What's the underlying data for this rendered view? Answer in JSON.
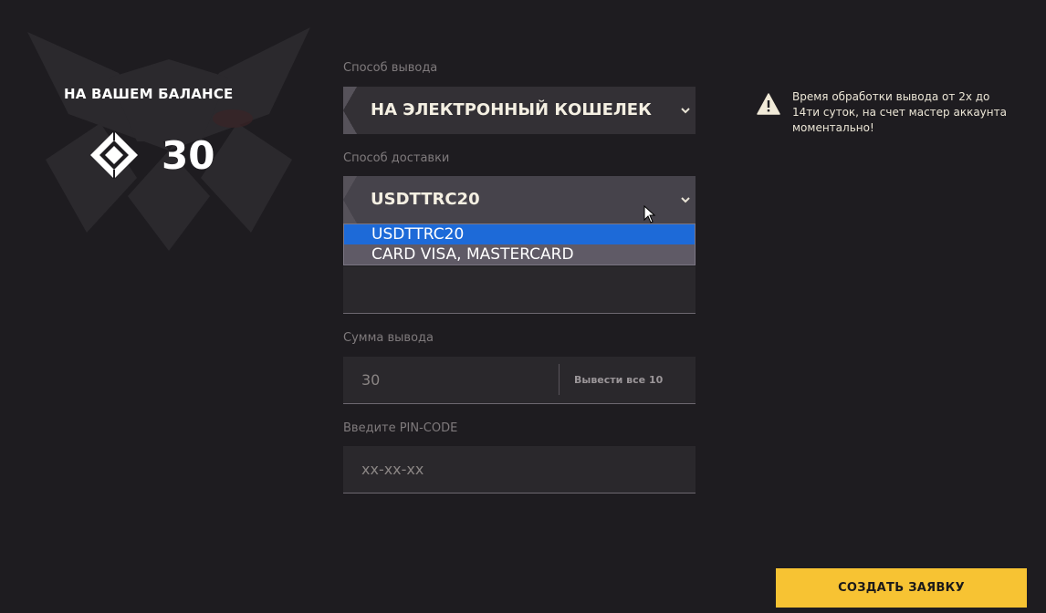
{
  "balance": {
    "title": "НА ВАШЕМ БАЛАНСЕ",
    "amount": "30",
    "icon": "crystal-icon"
  },
  "withdraw_method": {
    "label": "Способ вывода",
    "selected": "НА ЭЛЕКТРОННЫЙ КОШЕЛЕК"
  },
  "delivery_method": {
    "label": "Способ доставки",
    "selected": "USDTTRC20",
    "options": [
      "USDTTRC20",
      "CARD VISA, MASTERCARD"
    ]
  },
  "amount_field": {
    "label": "Сумма вывода",
    "value": "30",
    "max_button": "Вывести все 10"
  },
  "pin_field": {
    "label": "Введите PIN-CODE",
    "placeholder": "xx-xx-xx"
  },
  "notice": {
    "icon": "warning-icon",
    "text": "Время обработки вывода от 2х до 14ти суток, на счет мастер аккаунта моментально!"
  },
  "submit": {
    "label": "СОЗДАТЬ ЗАЯВКУ"
  },
  "colors": {
    "background": "#1e1c20",
    "accent": "#f7c333",
    "selected_option": "#1d6ad8"
  }
}
